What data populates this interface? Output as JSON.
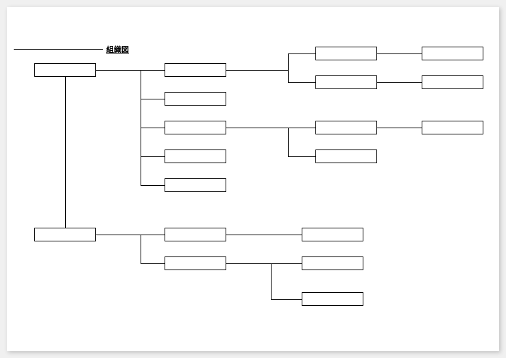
{
  "title": "組織図",
  "boxes": {
    "root1": "",
    "root2": "",
    "b1": "",
    "b2": "",
    "b3": "",
    "b4": "",
    "b5": "",
    "c1": "",
    "c2": "",
    "c3": "",
    "c4": "",
    "d1": "",
    "d2": "",
    "d3": "",
    "e1": "",
    "e2": "",
    "f1": "",
    "f2": "",
    "f3": ""
  }
}
